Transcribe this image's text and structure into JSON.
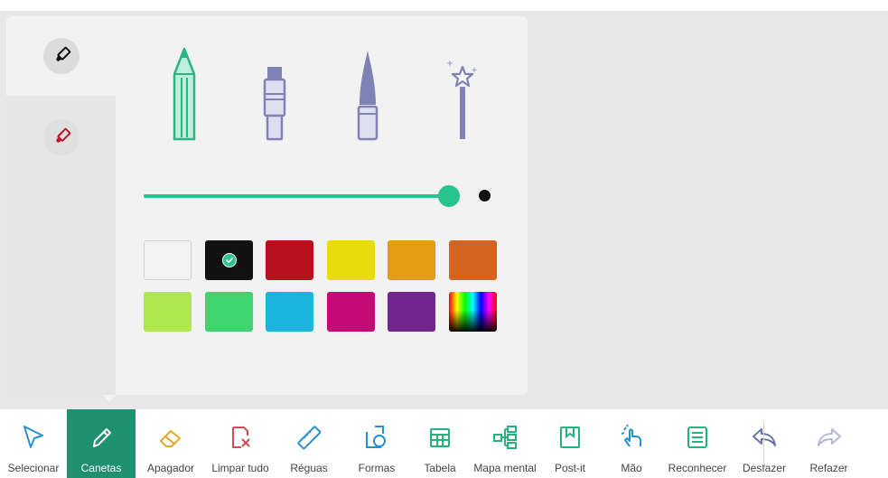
{
  "pen_panel": {
    "side_tabs": [
      {
        "id": "pen",
        "icon": "marker-icon",
        "active": true
      },
      {
        "id": "highlighter",
        "icon": "red-marker-icon",
        "active": false
      }
    ],
    "pen_types": [
      {
        "id": "pencil",
        "icon": "pencil-icon",
        "selected": true
      },
      {
        "id": "marker",
        "icon": "marker-pen-icon",
        "selected": false
      },
      {
        "id": "brush",
        "icon": "brush-pen-icon",
        "selected": false
      },
      {
        "id": "magic",
        "icon": "magic-wand-icon",
        "selected": false
      }
    ],
    "thickness": {
      "value": 1.0
    },
    "colors": {
      "accent": "#27c48d",
      "selected_index": 1,
      "swatches": [
        "#f3f3f3",
        "#111111",
        "#b8101f",
        "#eadb0e",
        "#e19e12",
        "#d46622",
        "#aee84e",
        "#3fd46d",
        "#1cb3de",
        "#c40a77",
        "#71258f",
        "spectrum"
      ]
    }
  },
  "toolbar": {
    "active_index": 1,
    "tools": [
      {
        "label": "Selecionar",
        "icon": "cursor-icon"
      },
      {
        "label": "Canetas",
        "icon": "pen-icon"
      },
      {
        "label": "Apagador",
        "icon": "eraser-icon"
      },
      {
        "label": "Limpar tudo",
        "icon": "clear-all-icon"
      },
      {
        "label": "Réguas",
        "icon": "ruler-icon"
      },
      {
        "label": "Formas",
        "icon": "shapes-icon"
      },
      {
        "label": "Tabela",
        "icon": "table-icon"
      },
      {
        "label": "Mapa mental",
        "icon": "mind-map-icon"
      },
      {
        "label": "Post-it",
        "icon": "post-it-icon"
      },
      {
        "label": "Mão",
        "icon": "hand-icon"
      },
      {
        "label": "Reconhecer",
        "icon": "recognize-icon"
      },
      {
        "label": "Desfazer",
        "icon": "undo-icon"
      },
      {
        "label": "Refazer",
        "icon": "redo-icon"
      }
    ]
  }
}
